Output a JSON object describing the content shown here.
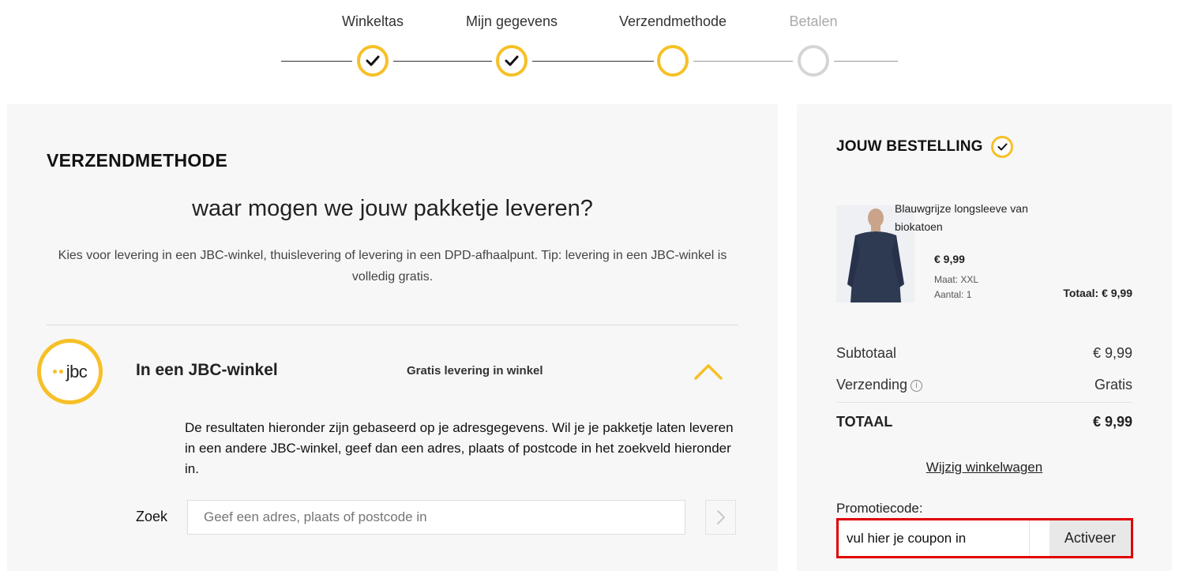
{
  "stepper": {
    "steps": [
      {
        "label": "Winkeltas",
        "state": "done"
      },
      {
        "label": "Mijn gegevens",
        "state": "done"
      },
      {
        "label": "Verzendmethode",
        "state": "current"
      },
      {
        "label": "Betalen",
        "state": "todo"
      }
    ]
  },
  "main": {
    "section_title": "VERZENDMETHODE",
    "headline": "waar mogen we jouw pakketje leveren?",
    "intro": "Kies voor levering in een JBC-winkel, thuislevering of levering in een DPD-afhaalpunt. Tip: levering in een JBC-winkel is volledig gratis.",
    "option": {
      "logo_text": "jbc",
      "title": "In een JBC-winkel",
      "tag": "Gratis levering in winkel",
      "description": "De resultaten hieronder zijn gebaseerd op je adresgegevens. Wil je je pakketje laten leveren in een andere JBC-winkel, geef dan een adres, plaats of postcode in het zoekveld hieronder in.",
      "search_label": "Zoek",
      "search_placeholder": "Geef een adres, plaats of postcode in"
    }
  },
  "order": {
    "title": "JOUW BESTELLING",
    "product": {
      "name": "Blauwgrijze longsleeve van biokatoen",
      "price": "€ 9,99",
      "size": "Maat: XXL",
      "qty": "Aantal: 1",
      "total": "Totaal: € 9,99"
    },
    "subtotal_label": "Subtotaal",
    "subtotal_value": "€ 9,99",
    "shipping_label": "Verzending",
    "shipping_value": "Gratis",
    "total_label": "TOTAAL",
    "total_value": "€ 9,99",
    "change_cart": "Wijzig winkelwagen",
    "promo_label": "Promotiecode:",
    "promo_value": "vul hier je coupon in",
    "promo_button": "Activeer"
  },
  "colors": {
    "accent": "#f6c026",
    "highlight": "#e00000"
  }
}
